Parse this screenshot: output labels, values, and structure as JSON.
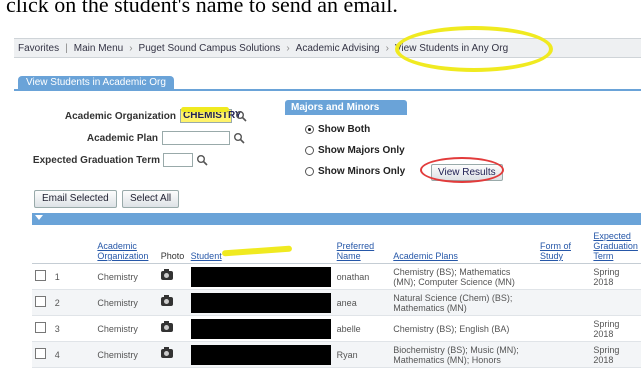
{
  "caption": "click on the student's name to send an email.",
  "breadcrumb": [
    "Favorites",
    "Main Menu",
    "Puget Sound Campus Solutions",
    "Academic Advising",
    "View Students in Any Org"
  ],
  "page_tab": "View Students in Academic Org",
  "form": {
    "acad_org_label": "Academic Organization",
    "acad_org_value": "CHEMISTRY",
    "acad_plan_label": "Academic Plan",
    "acad_plan_value": "",
    "grad_term_label": "Expected Graduation Term",
    "grad_term_value": ""
  },
  "majors_minors": {
    "title": "Majors and Minors",
    "options": [
      "Show Both",
      "Show Majors Only",
      "Show Minors Only"
    ],
    "selected": "Show Both",
    "view_results": "View Results"
  },
  "buttons": {
    "email_selected": "Email Selected",
    "select_all": "Select All"
  },
  "grid": {
    "headers": [
      "Academic Organization",
      "Photo",
      "Student",
      "Preferred Name",
      "Academic Plans",
      "Form of Study",
      "Expected Graduation Term"
    ],
    "rows": [
      {
        "num": "1",
        "org": "Chemistry",
        "pref": "onathan",
        "plans": "Chemistry (BS); Mathematics (MN); Computer Science (MN)",
        "term": "Spring 2018"
      },
      {
        "num": "2",
        "org": "Chemistry",
        "pref": "anea",
        "plans": "Natural Science (Chem) (BS); Mathematics (MN)",
        "term": ""
      },
      {
        "num": "3",
        "org": "Chemistry",
        "pref": "abelle",
        "plans": "Chemistry (BS); English (BA)",
        "term": "Spring 2018"
      },
      {
        "num": "4",
        "org": "Chemistry",
        "pref": "Ryan",
        "plans": "Biochemistry (BS); Music (MN); Mathematics (MN); Honors",
        "term": "Spring 2018"
      }
    ]
  },
  "colors": {
    "highlight_yellow": "#f0ea20",
    "highlight_red": "#e23b3b",
    "accent_blue": "#6aa3d8"
  }
}
